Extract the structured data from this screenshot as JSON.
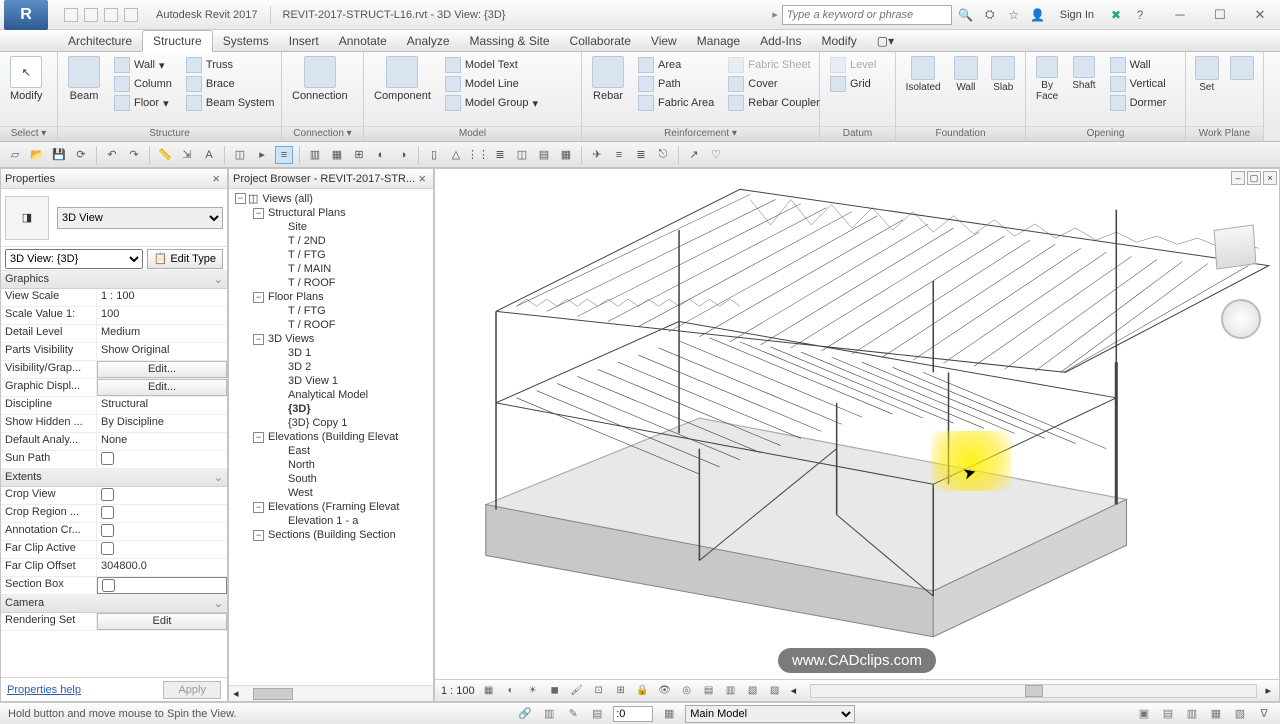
{
  "app": {
    "icon_letter": "R",
    "name": "Autodesk Revit 2017",
    "doc_title": "REVIT-2017-STRUCT-L16.rvt - 3D View: {3D}",
    "search_placeholder": "Type a keyword or phrase",
    "signin": "Sign In"
  },
  "tabs": [
    "Architecture",
    "Structure",
    "Systems",
    "Insert",
    "Annotate",
    "Analyze",
    "Massing & Site",
    "Collaborate",
    "View",
    "Manage",
    "Add-Ins",
    "Modify"
  ],
  "active_tab": "Structure",
  "ribbon": {
    "select": {
      "modify": "Modify",
      "label": "Select ▾"
    },
    "structure": {
      "beam": "Beam",
      "wall": "Wall",
      "column": "Column",
      "floor": "Floor",
      "truss": "Truss",
      "brace": "Brace",
      "beam_system": "Beam System",
      "label": "Structure"
    },
    "connection": {
      "connection": "Connection",
      "label": "Connection ▾"
    },
    "model": {
      "component": "Component",
      "text": "Model Text",
      "line": "Model Line",
      "group": "Model Group",
      "label": "Model"
    },
    "reinf": {
      "rebar": "Rebar",
      "area": "Area",
      "path": "Path",
      "fabric_area": "Fabric Area",
      "fabric_sheet": "Fabric Sheet",
      "cover": "Cover",
      "rebar_coupler": "Rebar Coupler",
      "label": "Reinforcement ▾"
    },
    "datum": {
      "level": "Level",
      "grid": "Grid",
      "label": "Datum"
    },
    "foundation": {
      "isolated": "Isolated",
      "wall": "Wall",
      "slab": "Slab",
      "label": "Foundation"
    },
    "opening": {
      "byface": "By\nFace",
      "shaft": "Shaft",
      "wall": "Wall",
      "vertical": "Vertical",
      "dormer": "Dormer",
      "label": "Opening"
    },
    "workplane": {
      "set": "Set",
      "label": "Work Plane"
    }
  },
  "properties": {
    "title": "Properties",
    "type": "3D View",
    "instance": "3D View: {3D}",
    "edit_type": "Edit Type",
    "sections": {
      "graphics": {
        "label": "Graphics",
        "rows": [
          {
            "k": "View Scale",
            "v": "1 : 100"
          },
          {
            "k": "Scale Value  1:",
            "v": "100"
          },
          {
            "k": "Detail Level",
            "v": "Medium"
          },
          {
            "k": "Parts Visibility",
            "v": "Show Original"
          },
          {
            "k": "Visibility/Grap...",
            "v": "Edit...",
            "btn": true
          },
          {
            "k": "Graphic Displ...",
            "v": "Edit...",
            "btn": true
          },
          {
            "k": "Discipline",
            "v": "Structural"
          },
          {
            "k": "Show Hidden ...",
            "v": "By Discipline"
          },
          {
            "k": "Default Analy...",
            "v": "None"
          },
          {
            "k": "Sun Path",
            "v": "",
            "check": true
          }
        ]
      },
      "extents": {
        "label": "Extents",
        "rows": [
          {
            "k": "Crop View",
            "v": "",
            "check": true
          },
          {
            "k": "Crop Region ...",
            "v": "",
            "check": true
          },
          {
            "k": "Annotation Cr...",
            "v": "",
            "check": true
          },
          {
            "k": "Far Clip Active",
            "v": "",
            "check": true
          },
          {
            "k": "Far Clip Offset",
            "v": "304800.0"
          },
          {
            "k": "Section Box",
            "v": "",
            "check": true,
            "input": true
          }
        ]
      },
      "camera": {
        "label": "Camera",
        "rows": [
          {
            "k": "Rendering Set",
            "v": "Edit",
            "btn": true
          }
        ]
      }
    },
    "help": "Properties help",
    "apply": "Apply"
  },
  "browser": {
    "title": "Project Browser - REVIT-2017-STR...",
    "tree": [
      {
        "d": 0,
        "t": "Views (all)",
        "e": "-",
        "icon": true
      },
      {
        "d": 1,
        "t": "Structural Plans",
        "e": "-"
      },
      {
        "d": 2,
        "t": "Site"
      },
      {
        "d": 2,
        "t": "T / 2ND"
      },
      {
        "d": 2,
        "t": "T / FTG"
      },
      {
        "d": 2,
        "t": "T / MAIN"
      },
      {
        "d": 2,
        "t": "T / ROOF"
      },
      {
        "d": 1,
        "t": "Floor Plans",
        "e": "-"
      },
      {
        "d": 2,
        "t": "T / FTG"
      },
      {
        "d": 2,
        "t": "T / ROOF"
      },
      {
        "d": 1,
        "t": "3D Views",
        "e": "-"
      },
      {
        "d": 2,
        "t": "3D 1"
      },
      {
        "d": 2,
        "t": "3D 2"
      },
      {
        "d": 2,
        "t": "3D View 1"
      },
      {
        "d": 2,
        "t": "Analytical Model"
      },
      {
        "d": 2,
        "t": "{3D}",
        "sel": true
      },
      {
        "d": 2,
        "t": "{3D} Copy 1"
      },
      {
        "d": 1,
        "t": "Elevations (Building Elevat",
        "e": "-"
      },
      {
        "d": 2,
        "t": "East"
      },
      {
        "d": 2,
        "t": "North"
      },
      {
        "d": 2,
        "t": "South"
      },
      {
        "d": 2,
        "t": "West"
      },
      {
        "d": 1,
        "t": "Elevations (Framing Elevat",
        "e": "-"
      },
      {
        "d": 2,
        "t": "Elevation 1 - a"
      },
      {
        "d": 1,
        "t": "Sections (Building Section",
        "e": "-"
      }
    ]
  },
  "viewport": {
    "scale": "1 : 100",
    "watermark": "www.CADclips.com"
  },
  "status": {
    "hint": "Hold button and move mouse to Spin the View.",
    "filter": ":0",
    "model": "Main Model"
  }
}
